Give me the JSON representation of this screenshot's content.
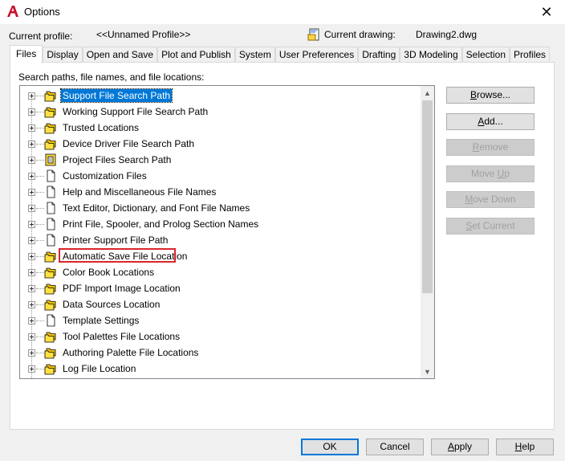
{
  "window": {
    "title": "Options",
    "close_glyph": "✕"
  },
  "profile": {
    "current_profile_label": "Current profile:",
    "current_profile_value": "<<Unnamed Profile>>",
    "current_drawing_label": "Current drawing:",
    "current_drawing_value": "Drawing2.dwg"
  },
  "tabs": [
    {
      "label": "Files",
      "active": true
    },
    {
      "label": "Display"
    },
    {
      "label": "Open and Save"
    },
    {
      "label": "Plot and Publish"
    },
    {
      "label": "System"
    },
    {
      "label": "User Preferences"
    },
    {
      "label": "Drafting"
    },
    {
      "label": "3D Modeling"
    },
    {
      "label": "Selection"
    },
    {
      "label": "Profiles"
    }
  ],
  "files": {
    "section_label": "Search paths, file names, and file locations:",
    "tree": [
      {
        "label": "Support File Search Path",
        "icon": "folder-stack-icon",
        "selected": true
      },
      {
        "label": "Working Support File Search Path",
        "icon": "folder-stack-icon"
      },
      {
        "label": "Trusted Locations",
        "icon": "folder-stack-icon"
      },
      {
        "label": "Device Driver File Search Path",
        "icon": "folder-stack-icon"
      },
      {
        "label": "Project Files Search Path",
        "icon": "project-files-icon"
      },
      {
        "label": "Customization Files",
        "icon": "document-icon"
      },
      {
        "label": "Help and Miscellaneous File Names",
        "icon": "document-icon"
      },
      {
        "label": "Text Editor, Dictionary, and Font File Names",
        "icon": "document-icon"
      },
      {
        "label": "Print File, Spooler, and Prolog Section Names",
        "icon": "document-icon"
      },
      {
        "label": "Printer Support File Path",
        "icon": "document-icon"
      },
      {
        "label": "Automatic Save File Location",
        "icon": "folder-stack-icon",
        "highlighted": true
      },
      {
        "label": "Color Book Locations",
        "icon": "folder-stack-icon"
      },
      {
        "label": "PDF Import Image Location",
        "icon": "folder-stack-icon"
      },
      {
        "label": "Data Sources Location",
        "icon": "folder-stack-icon"
      },
      {
        "label": "Template Settings",
        "icon": "document-icon"
      },
      {
        "label": "Tool Palettes File Locations",
        "icon": "folder-stack-icon"
      },
      {
        "label": "Authoring Palette File Locations",
        "icon": "folder-stack-icon"
      },
      {
        "label": "Log File Location",
        "icon": "folder-stack-icon"
      }
    ]
  },
  "side_buttons": {
    "browse": {
      "pre": "",
      "ul": "B",
      "post": "rowse..."
    },
    "add": {
      "pre": "",
      "ul": "A",
      "post": "dd..."
    },
    "remove": {
      "pre": "",
      "ul": "R",
      "post": "emove"
    },
    "move_up": {
      "pre": "Move ",
      "ul": "U",
      "post": "p"
    },
    "move_down": {
      "pre": "",
      "ul": "M",
      "post": "ove Down"
    },
    "set_current": {
      "pre": "",
      "ul": "S",
      "post": "et Current"
    }
  },
  "bottom_buttons": {
    "ok": "OK",
    "cancel": "Cancel",
    "apply": {
      "pre": "",
      "ul": "A",
      "post": "pply"
    },
    "help": {
      "pre": "",
      "ul": "H",
      "post": "elp"
    }
  },
  "colors": {
    "accent": "#0078d7",
    "highlight_box": "#d9262c",
    "folder_yellow": "#ffe040",
    "app_red": "#c8102e"
  }
}
